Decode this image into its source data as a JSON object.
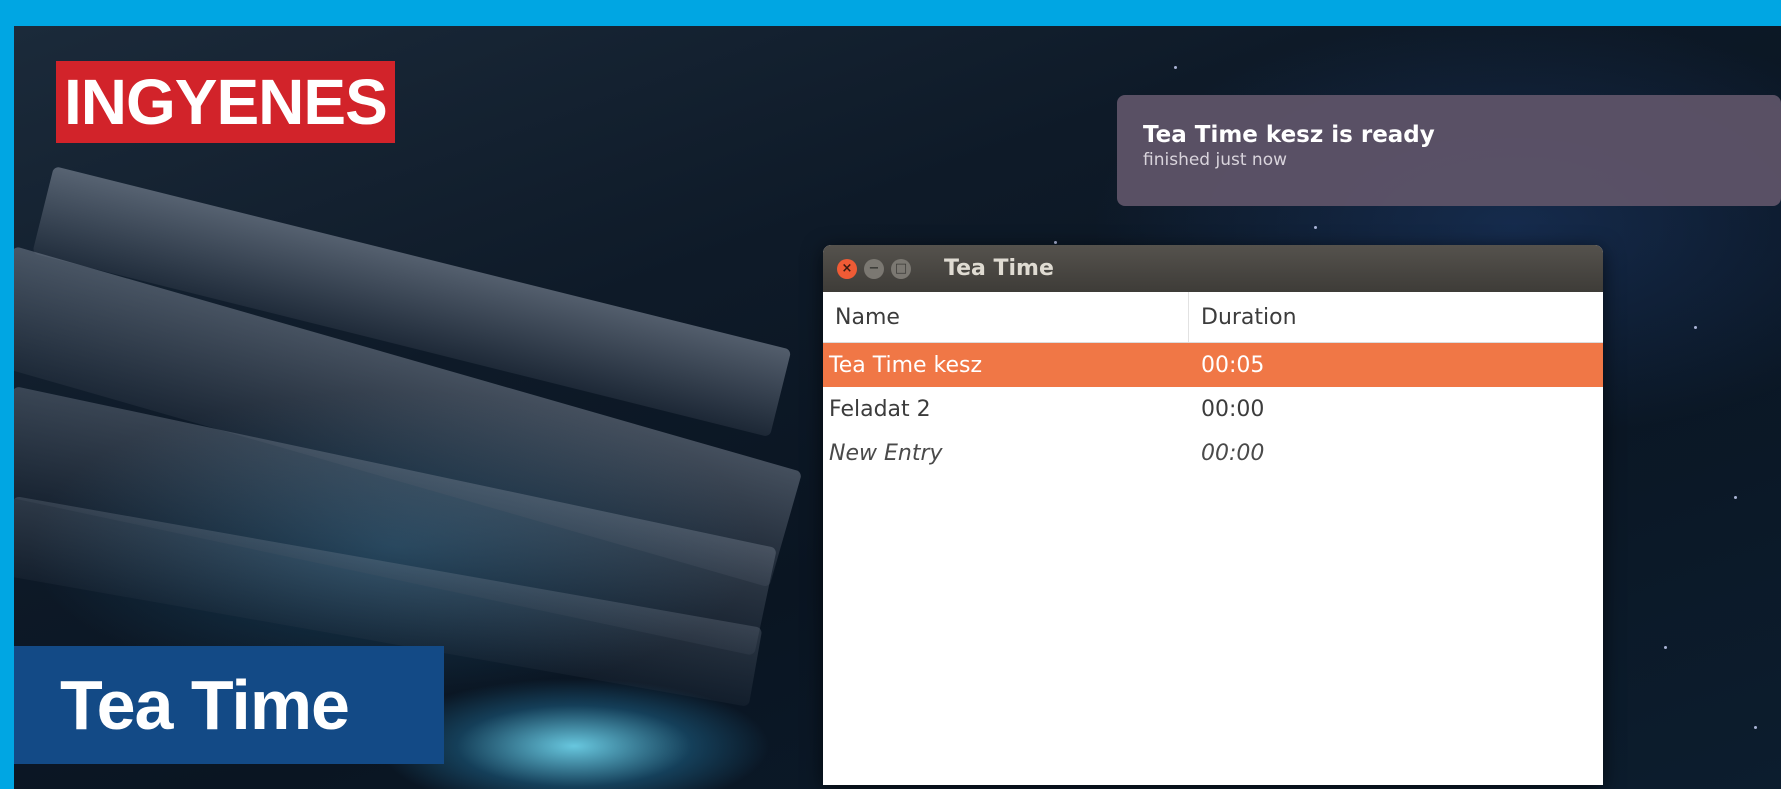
{
  "badge": {
    "label": "INGYENES",
    "color": "#d2232a"
  },
  "banner": {
    "title": "Tea Time",
    "color": "#134a86"
  },
  "notification": {
    "title": "Tea Time kesz is ready",
    "body": "finished just now"
  },
  "window": {
    "title": "Tea Time",
    "buttons": {
      "close": "×",
      "minimize": "−",
      "maximize": "□"
    },
    "columns": {
      "name": "Name",
      "duration": "Duration"
    },
    "rows": [
      {
        "name": "Tea Time kesz",
        "duration": "00:05",
        "selected": true
      },
      {
        "name": "Feladat 2",
        "duration": "00:00",
        "selected": false
      },
      {
        "name": "New Entry",
        "duration": "00:00",
        "selected": false
      }
    ],
    "accent": "#f07746"
  }
}
